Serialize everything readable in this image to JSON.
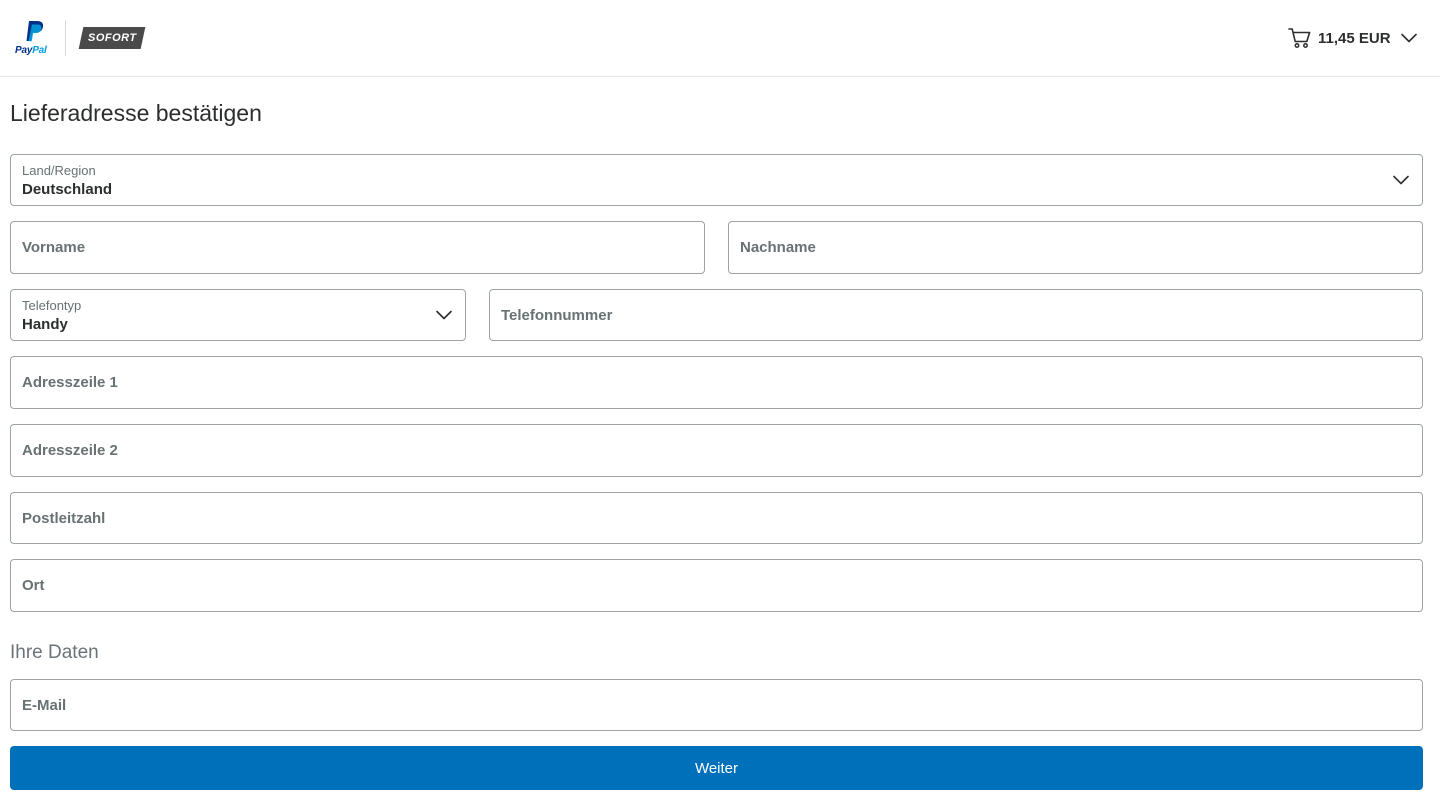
{
  "header": {
    "paypal_logo_text": [
      "Pay",
      "Pal"
    ],
    "sofort_logo_text": "SOFORT",
    "cart_amount": "11,45 EUR"
  },
  "form": {
    "title": "Lieferadresse bestätigen",
    "country": {
      "label": "Land/Region",
      "value": "Deutschland"
    },
    "first_name": {
      "placeholder": "Vorname"
    },
    "last_name": {
      "placeholder": "Nachname"
    },
    "phone_type": {
      "label": "Telefontyp",
      "value": "Handy"
    },
    "phone_number": {
      "placeholder": "Telefonnummer"
    },
    "address_line1": {
      "placeholder": "Adresszeile 1"
    },
    "address_line2": {
      "placeholder": "Adresszeile 2"
    },
    "postal_code": {
      "placeholder": "Postleitzahl"
    },
    "city": {
      "placeholder": "Ort"
    }
  },
  "your_data": {
    "title": "Ihre Daten",
    "email": {
      "placeholder": "E-Mail"
    }
  },
  "submit_label": "Weiter",
  "colors": {
    "primary_button": "#0070ba",
    "paypal_dark_blue": "#003087",
    "paypal_light_blue": "#009cde",
    "sofort_badge": "#4a4a4a",
    "field_border": "#9da3a6"
  },
  "icons": {
    "cart": "shopping-cart-icon",
    "dropdown": "chevron-down-icon"
  }
}
